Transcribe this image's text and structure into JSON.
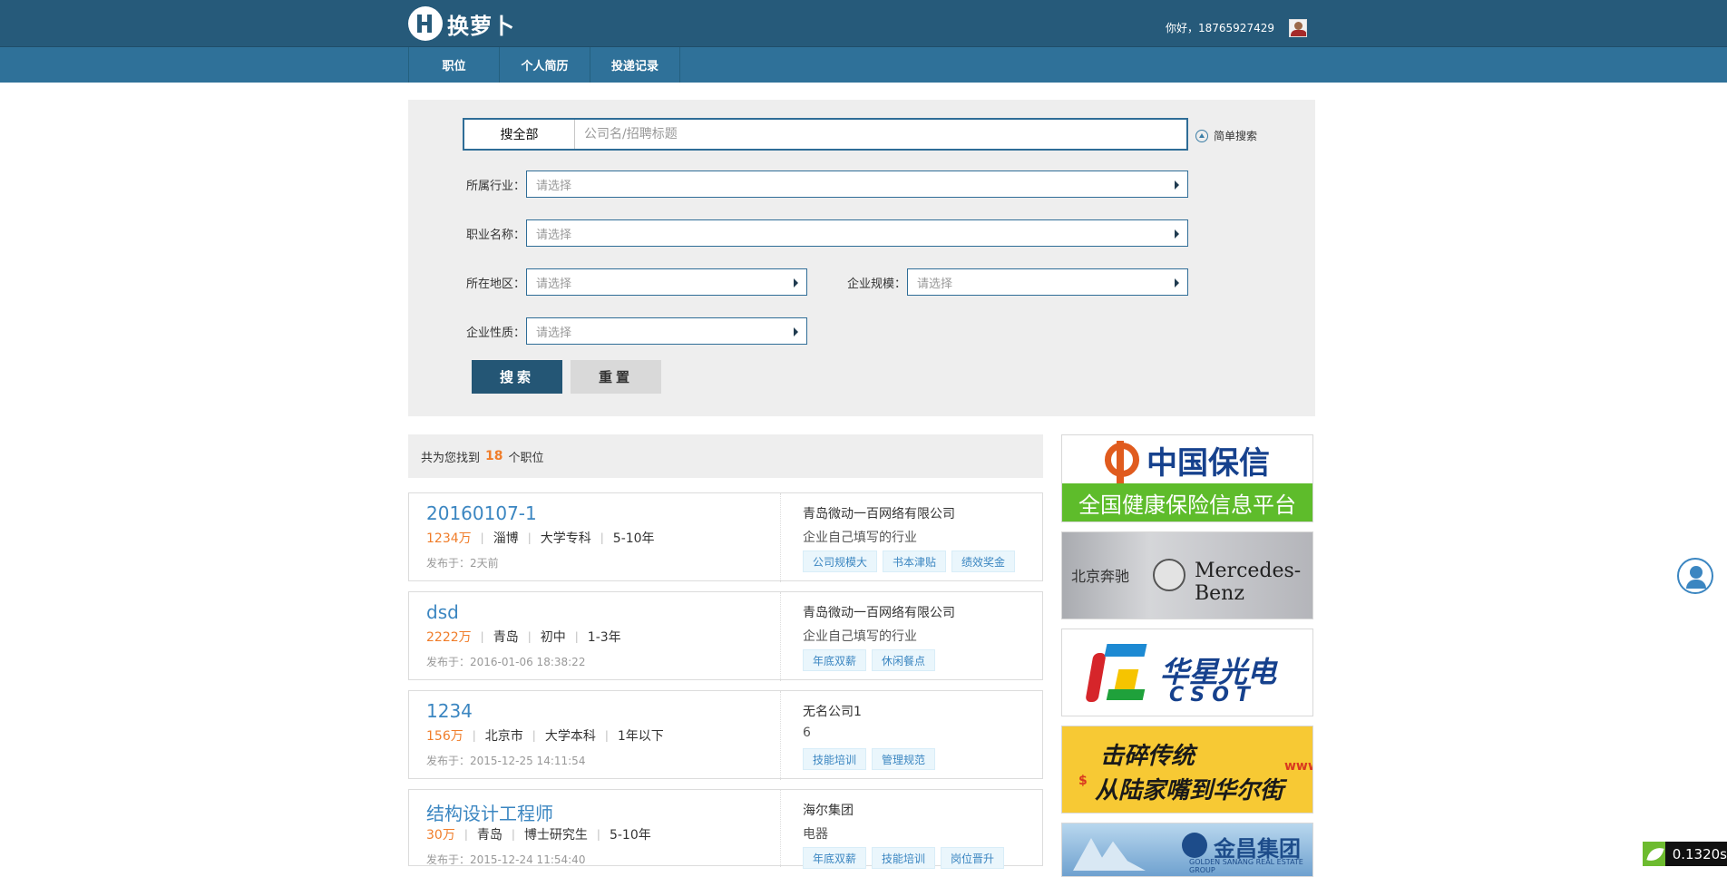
{
  "header": {
    "logo_text": "换萝卜",
    "logo_sub": "",
    "greeting": "你好，18765927429"
  },
  "nav": {
    "items": [
      {
        "label": "职位"
      },
      {
        "label": "个人简历"
      },
      {
        "label": "投递记录"
      }
    ]
  },
  "search": {
    "scope": "搜全部",
    "placeholder": "公司名/招聘标题",
    "simple_search": "简单搜索",
    "fields": {
      "industry": {
        "label": "所属行业：",
        "value": "请选择"
      },
      "job_name": {
        "label": "职业名称：",
        "value": "请选择"
      },
      "region": {
        "label": "所在地区：",
        "value": "请选择"
      },
      "scale": {
        "label": "企业规模：",
        "value": "请选择"
      },
      "nature": {
        "label": "企业性质：",
        "value": "请选择"
      }
    },
    "search_button": "搜索",
    "reset_button": "重置"
  },
  "results": {
    "prefix": "共为您找到",
    "count": "18",
    "suffix": "个职位"
  },
  "jobs": [
    {
      "title": "20160107-1",
      "salary": "1234万",
      "location": "淄博",
      "education": "大学专科",
      "experience": "5-10年",
      "date": "发布于：2天前",
      "company": "青岛微动一百网络有限公司",
      "industry": "企业自己填写的行业",
      "tags": [
        "公司规模大",
        "书本津贴",
        "绩效奖金"
      ]
    },
    {
      "title": "dsd",
      "salary": "2222万",
      "location": "青岛",
      "education": "初中",
      "experience": "1-3年",
      "date": "发布于：2016-01-06 18:38:22",
      "company": "青岛微动一百网络有限公司",
      "industry": "企业自己填写的行业",
      "tags": [
        "年底双薪",
        "休闲餐点"
      ]
    },
    {
      "title": "1234",
      "salary": "156万",
      "location": "北京市",
      "education": "大学本科",
      "experience": "1年以下",
      "date": "发布于：2015-12-25 14:11:54",
      "company": "无名公司1",
      "industry": "6",
      "tags": [
        "技能培训",
        "管理规范"
      ]
    },
    {
      "title": "结构设计工程师",
      "salary": "30万",
      "location": "青岛",
      "education": "博士研究生",
      "experience": "5-10年",
      "date": "发布于：2015-12-24 11:54:40",
      "company": "海尔集团",
      "industry": "电器",
      "tags": [
        "年底双薪",
        "技能培训",
        "岗位晋升"
      ]
    }
  ],
  "ads": {
    "ad1_brand": "中国保信",
    "ad1_slogan": "全国健康保险信息平台",
    "ad2_cn": "北京奔驰",
    "ad2_en": "Mercedes-Benz",
    "ad3_brand": "华星光电",
    "ad3_sub": "CSOT",
    "ad4_line1": "击碎传统",
    "ad4_line2": "从陆家嘴到华尔街",
    "ad5_brand": "金昌集团",
    "ad5_sub": "GOLDEN SANANG REAL ESTATE GROUP"
  },
  "timer": {
    "value": "0.1320s"
  },
  "colors": {
    "header_bg": "#265a7a",
    "nav_bg": "#2f7199",
    "accent": "#3b86c1",
    "salary": "#f07d2a"
  }
}
